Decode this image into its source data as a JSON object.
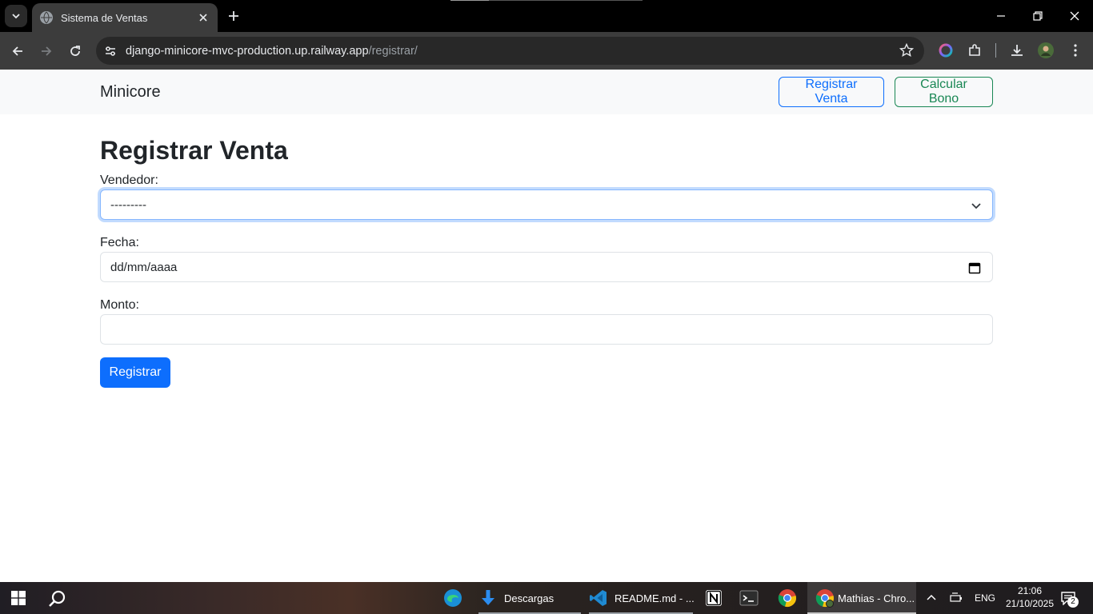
{
  "browser": {
    "tab": {
      "title": "Sistema de Ventas"
    },
    "address": {
      "domain": "django-minicore-mvc-production.up.railway.app",
      "path": "/registrar/"
    }
  },
  "navbar": {
    "brand": "Minicore",
    "links": [
      {
        "label": "Registrar Venta",
        "color": "#0d6efd"
      },
      {
        "label": "Calcular Bono",
        "color": "#198754"
      }
    ]
  },
  "form": {
    "title": "Registrar Venta",
    "vendedor": {
      "label": "Vendedor:",
      "value": "---------"
    },
    "fecha": {
      "label": "Fecha:",
      "placeholder": "dd/mm/aaaa"
    },
    "monto": {
      "label": "Monto:",
      "value": ""
    },
    "submit": "Registrar"
  },
  "taskbar": {
    "apps": [
      {
        "name": "edge-icon",
        "label": ""
      },
      {
        "name": "downloads-icon",
        "label": "Descargas"
      },
      {
        "name": "vscode-icon",
        "label": "README.md - ..."
      },
      {
        "name": "notion-icon",
        "label": ""
      },
      {
        "name": "terminal-icon",
        "label": ""
      },
      {
        "name": "chrome-icon",
        "label": ""
      },
      {
        "name": "chrome-profile-icon",
        "label": "Mathias - Chro..."
      }
    ],
    "tray": {
      "language": "ENG",
      "time": "21:06",
      "date": "21/10/2025",
      "notifications": "2"
    }
  },
  "colors": {
    "primary": "#0d6efd",
    "success": "#198754",
    "navbar_bg": "#f8f9fa"
  }
}
